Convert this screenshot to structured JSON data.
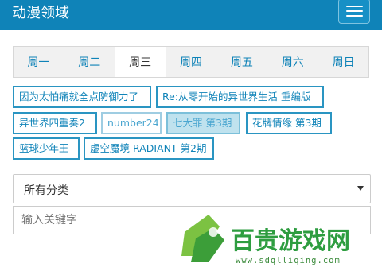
{
  "header": {
    "brand": "动漫领域",
    "menu_icon": "hamburger-icon"
  },
  "tabs": [
    {
      "label": "周一"
    },
    {
      "label": "周二"
    },
    {
      "label": "周三",
      "active": true
    },
    {
      "label": "周四"
    },
    {
      "label": "周五"
    },
    {
      "label": "周六"
    },
    {
      "label": "周日"
    }
  ],
  "anime": [
    {
      "title": "因为太怕痛就全点防御力了"
    },
    {
      "title": "Re:从零开始的异世界生活 重编版"
    },
    {
      "title": "异世界四重奏2"
    },
    {
      "title": "number24"
    },
    {
      "title": "七大罪 第3期"
    },
    {
      "title": "花牌情缘 第3期"
    },
    {
      "title": "篮球少年王"
    },
    {
      "title": "虚空魔境 RADIANT 第2期"
    }
  ],
  "filter": {
    "category_selected": "所有分类"
  },
  "search": {
    "placeholder": "输入关键字"
  },
  "watermark": {
    "name": "百贵游戏网",
    "url": "www.sdqlliqing.com"
  },
  "colors": {
    "accent": "#0f83b8",
    "tag_border": "#2a95c2",
    "highlight": "#bfe2ee"
  }
}
